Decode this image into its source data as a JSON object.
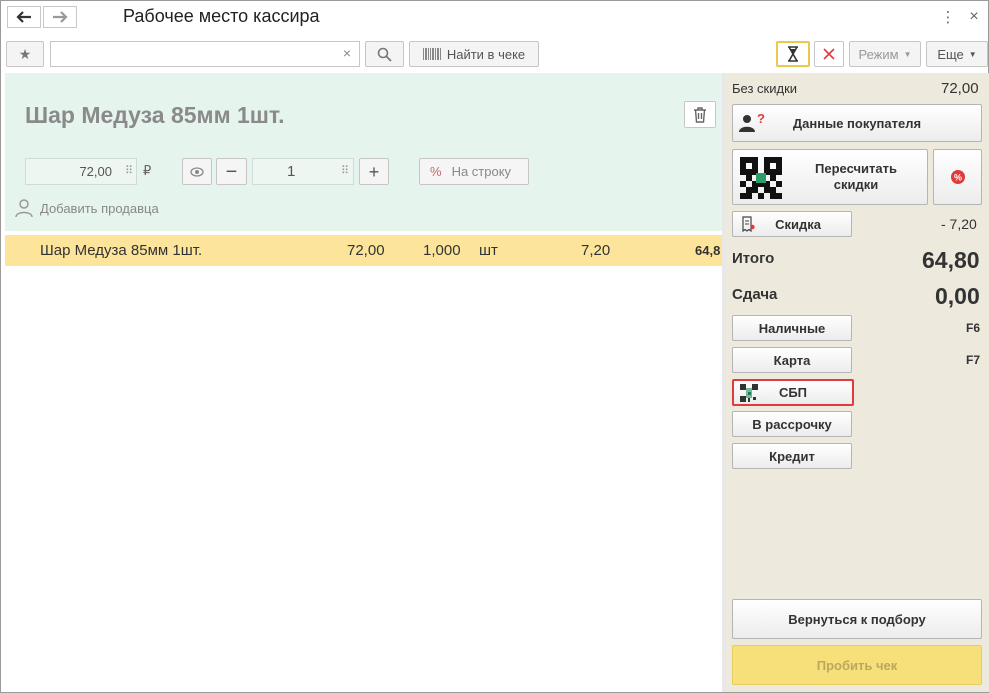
{
  "header": {
    "title": "Рабочее место кассира",
    "back_icon": "arrow-left-icon",
    "forward_icon": "arrow-right-icon"
  },
  "toolbar": {
    "search_clear": "×",
    "find_in_receipt": "Найти в чеке",
    "mode": "Режим",
    "more": "Еще"
  },
  "product": {
    "title": "Шар Медуза 85мм 1шт.",
    "price": "72,00",
    "currency": "₽",
    "quantity": "1",
    "discount_to_row": "На строку",
    "add_seller": "Добавить продавца"
  },
  "receipt_rows": [
    {
      "name": "Шар Медуза 85мм 1шт.",
      "price": "72,00",
      "qty": "1,000",
      "unit": "шт",
      "discount": "7,20",
      "sum": "64,8"
    }
  ],
  "summary": {
    "no_discount_label": "Без скидки",
    "no_discount_value": "72,00",
    "customer_data": "Данные покупателя",
    "recalc_discounts": "Пересчитать скидки",
    "discount_btn": "Скидка",
    "discount_value": "- 7,20",
    "total_label": "Итого",
    "total_value": "64,80",
    "change_label": "Сдача",
    "change_value": "0,00"
  },
  "payments": {
    "cash": "Наличные",
    "cash_key": "F6",
    "card": "Карта",
    "card_key": "F7",
    "sbp": "СБП",
    "installment": "В рассрочку",
    "credit": "Кредит"
  },
  "footer": {
    "back_to_selection": "Вернуться к подбору",
    "print_receipt": "Пробить чек"
  },
  "colors": {
    "green_panel": "#e6f4ee",
    "row_highlight": "#fce59a",
    "right_panel": "#ede9dd",
    "print_button": "#f7e07a",
    "highlight_border": "#e03a3a"
  }
}
